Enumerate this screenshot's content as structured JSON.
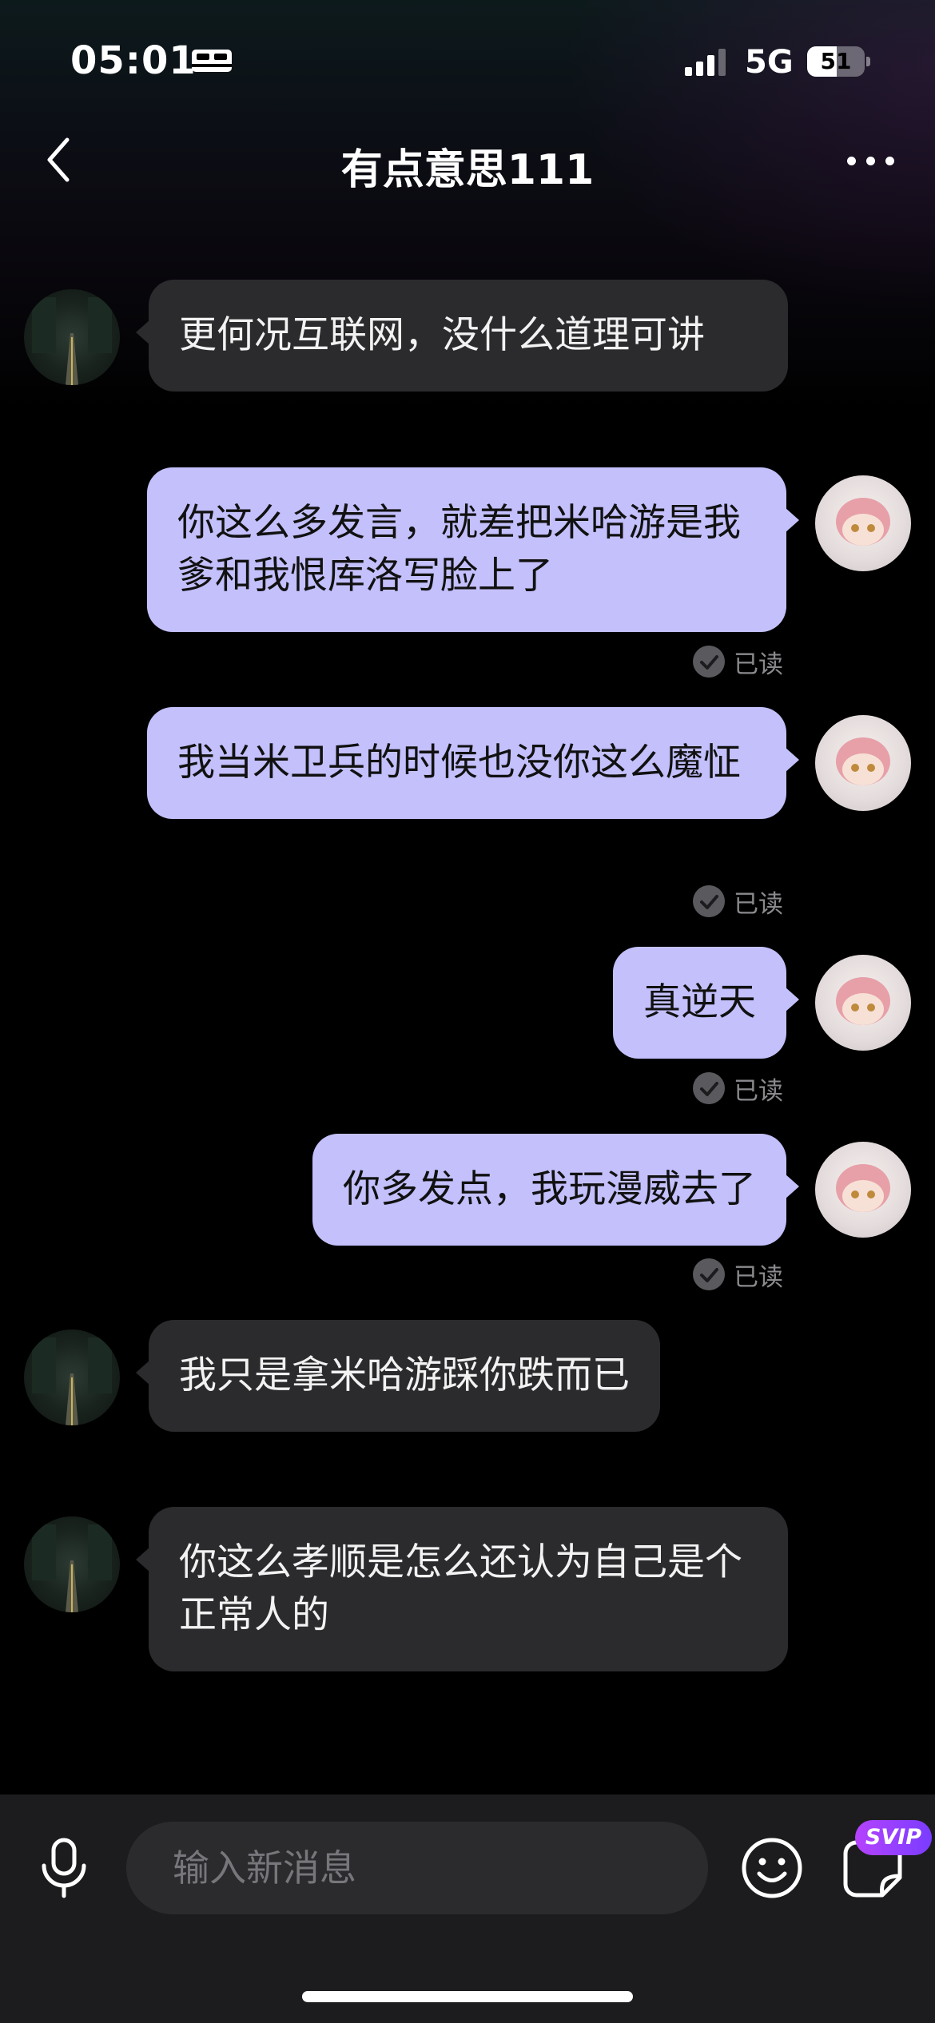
{
  "status_bar": {
    "time": "05:01",
    "network": "5G",
    "battery": "51",
    "battery_level_percent": 51
  },
  "header": {
    "title": "有点意思111",
    "back_icon": "chevron-left-icon",
    "more_icon": "more-horizontal-icon"
  },
  "messages": [
    {
      "side": "in",
      "text": "更何况互联网，没什么道理可讲"
    },
    {
      "side": "out",
      "text": "你这么多发言，就差把米哈游是我爹和我恨库洛写脸上了",
      "read": "已读"
    },
    {
      "side": "out",
      "text": "我当米卫兵的时候也没你这么魔怔",
      "read": "已读"
    },
    {
      "side": "out",
      "text": "真逆天",
      "read": "已读"
    },
    {
      "side": "out",
      "text": "你多发点，我玩漫威去了",
      "read": "已读"
    },
    {
      "side": "in",
      "text": "我只是拿米哈游踩你跌而已"
    },
    {
      "side": "in",
      "text": "你这么孝顺是怎么还认为自己是个正常人的"
    }
  ],
  "composer": {
    "placeholder": "输入新消息",
    "svip_badge": "SVIP"
  },
  "colors": {
    "outgoing_bubble": "#c3c0fc",
    "incoming_bubble": "#2b2b2e",
    "svip": "#9b3cff"
  }
}
